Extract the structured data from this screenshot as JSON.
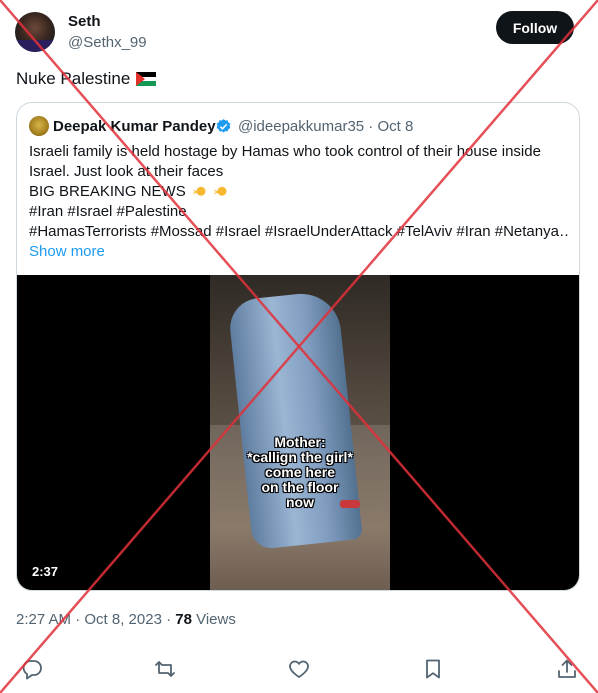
{
  "author": {
    "name": "Seth",
    "handle": "@Sethx_99"
  },
  "follow_label": "Follow",
  "tweet_text": "Nuke Palestine",
  "quoted": {
    "name": "Deepak Kumar Pandey",
    "handle_date": "@ideepakkumar35 · Oct 8",
    "lines": [
      "Israeli family is held hostage by Hamas who took control of their house inside",
      "Israel. Just look at their faces",
      "BIG BREAKING NEWS",
      "#Iran #Israel #Palestine",
      "#HamasTerrorists #Mossad #Israel #IsraelUnderAttack #TelAviv #Iran #Netanya…"
    ],
    "show_more": "Show more",
    "video": {
      "caption": [
        "Mother:",
        "*callign the girl*",
        "come here",
        "on the floor",
        "now"
      ],
      "duration": "2:37"
    }
  },
  "meta": {
    "time_date": "2:27 AM · Oct 8, 2023 · ",
    "views_count": "78",
    "views_label": " Views"
  },
  "colors": {
    "accent": "#1d9bf0",
    "cross": "#e0303a"
  },
  "icons": [
    "reply-icon",
    "retweet-icon",
    "like-icon",
    "bookmark-icon",
    "share-icon",
    "verified-icon",
    "flag-palestine-icon",
    "sparkle-icon"
  ]
}
